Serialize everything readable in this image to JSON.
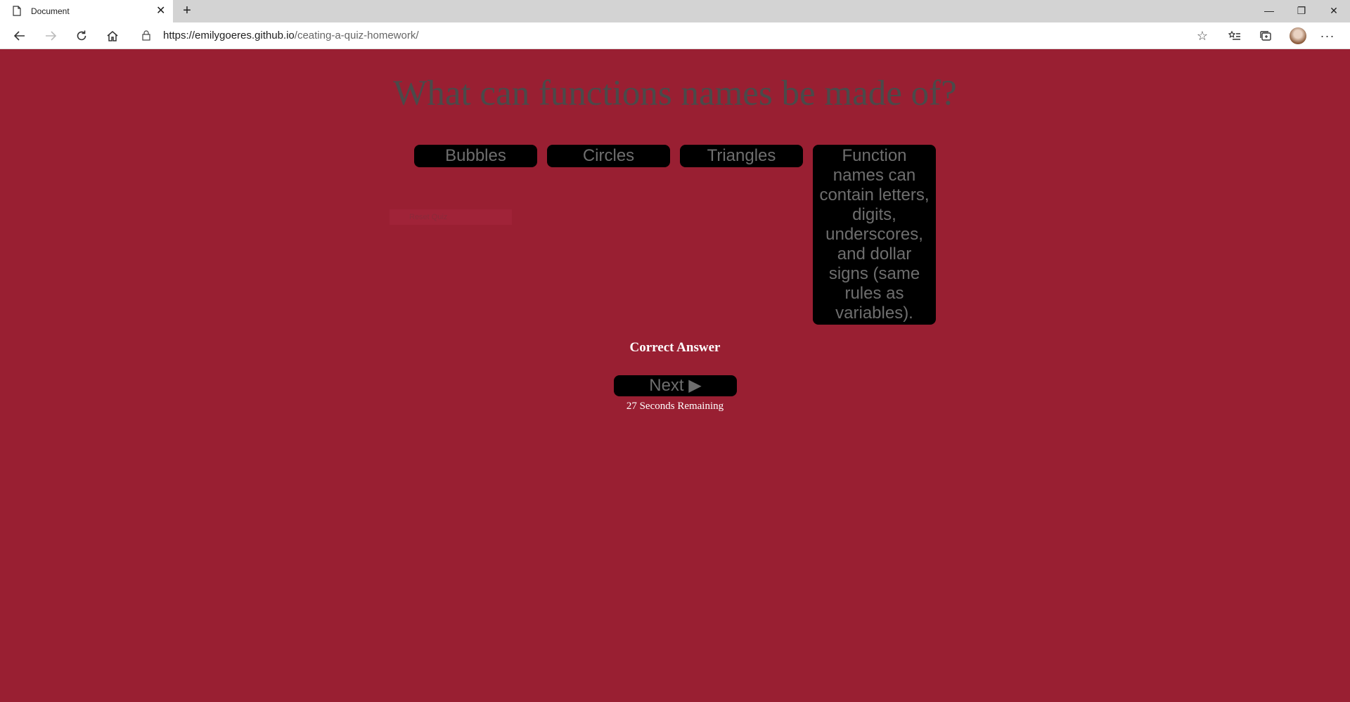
{
  "browser": {
    "tab_title": "Document",
    "tab_close": "✕",
    "new_tab": "+",
    "url_host": "https://emilygoeres.github.io",
    "url_path": "/ceating-a-quiz-homework/",
    "window_controls": {
      "minimize": "—",
      "restore": "❐",
      "close": "✕"
    },
    "menu": "···"
  },
  "quiz": {
    "question": "What can functions names be made of?",
    "answers": [
      "Bubbles",
      "Circles",
      "Triangles",
      "Function names can contain letters, digits, underscores, and dollar signs (same rules as variables)."
    ],
    "faint_box_text": "Reset Quiz",
    "result": "Correct Answer",
    "next_label": "Next ▶",
    "timer_text": "27 Seconds Remaining"
  },
  "colors": {
    "background": "#991f32",
    "button": "#000000",
    "button_text": "#6e6e6e",
    "question_text": "#4a4a4a"
  }
}
